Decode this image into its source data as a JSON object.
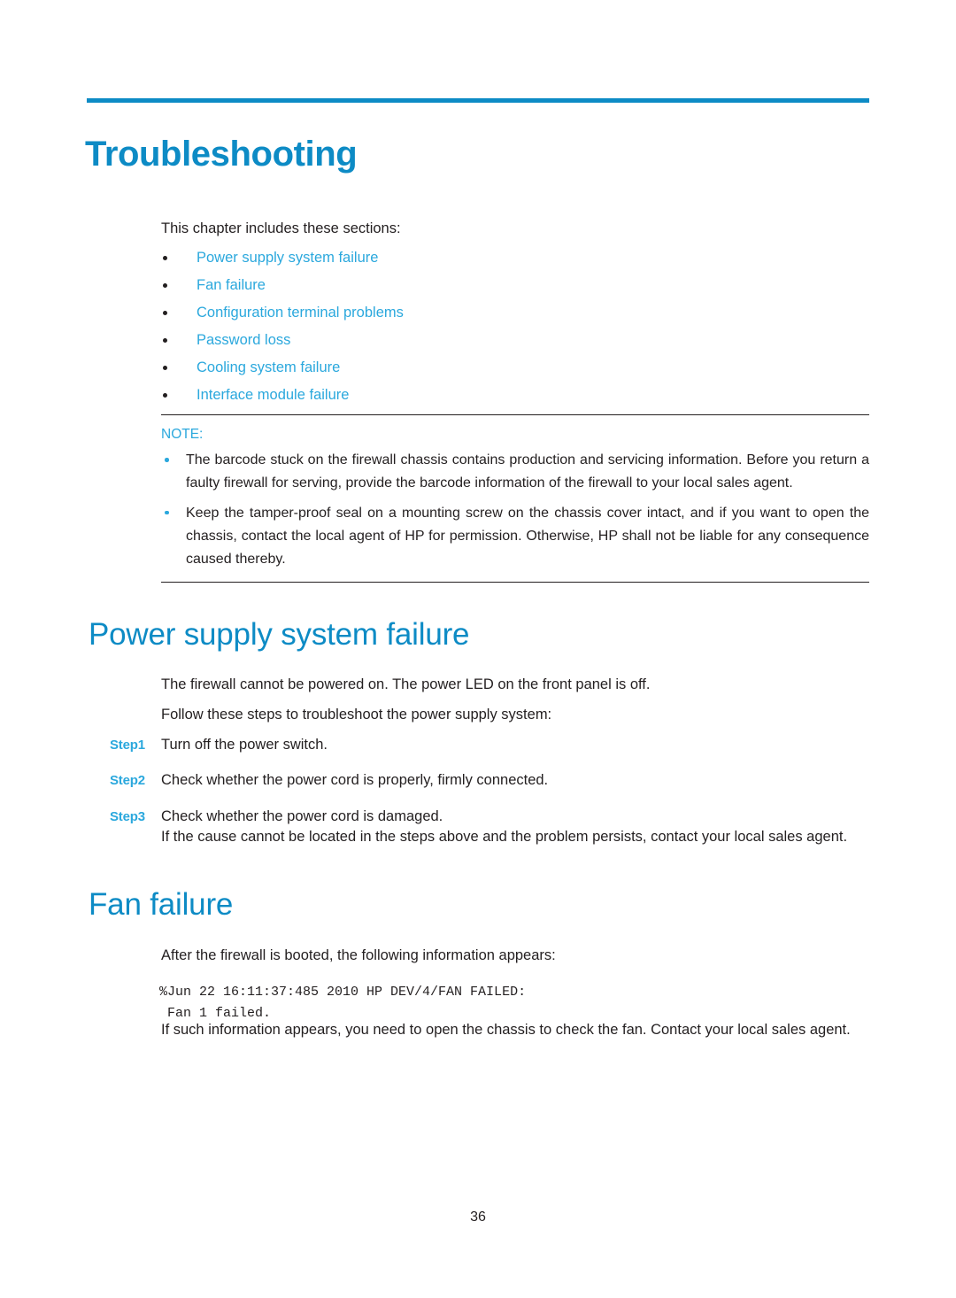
{
  "chapter": {
    "title": "Troubleshooting",
    "rule_color": "#0d8bc5",
    "title_color": "#0d8bc5"
  },
  "intro": {
    "text": "This chapter includes these sections:"
  },
  "toc": {
    "link_color": "#2ba8dd",
    "items": [
      {
        "label": "Power supply system failure"
      },
      {
        "label": "Fan failure"
      },
      {
        "label": "Configuration terminal problems"
      },
      {
        "label": "Password loss"
      },
      {
        "label": "Cooling system failure"
      },
      {
        "label": "Interface module failure"
      }
    ]
  },
  "note": {
    "label": "NOTE:",
    "label_color": "#2ba8dd",
    "items": [
      {
        "text": "The barcode stuck on the firewall chassis contains production and servicing information. Before you return a faulty firewall for serving, provide the barcode information of the firewall to your local sales agent."
      },
      {
        "text": "Keep the tamper-proof seal on a mounting screw on the chassis cover intact, and if you want to open the chassis, contact the local agent of HP for permission. Otherwise, HP shall not be liable for any consequence caused thereby."
      }
    ]
  },
  "power_section": {
    "heading": "Power supply system failure",
    "paragraph_1": "The firewall cannot be powered on. The power LED on the front panel is off.",
    "paragraph_2": "Follow these steps to troubleshoot the power supply system:",
    "steps": [
      {
        "label": "Step1",
        "text": "Turn off the power switch."
      },
      {
        "label": "Step2",
        "text": "Check whether the power cord is properly, firmly connected."
      },
      {
        "label": "Step3",
        "text": "Check whether the power cord is damaged."
      }
    ],
    "paragraph_3": "If the cause cannot be located in the steps above and the problem persists, contact your local sales agent."
  },
  "fan_section": {
    "heading": "Fan failure",
    "paragraph_1": "After the firewall is booted, the following information appears:",
    "code": "%Jun 22 16:11:37:485 2010 HP DEV/4/FAN FAILED:\n Fan 1 failed.",
    "paragraph_2": "If such information appears, you need to open the chassis to check the fan. Contact your local sales agent."
  },
  "footer": {
    "page_number": "36"
  }
}
